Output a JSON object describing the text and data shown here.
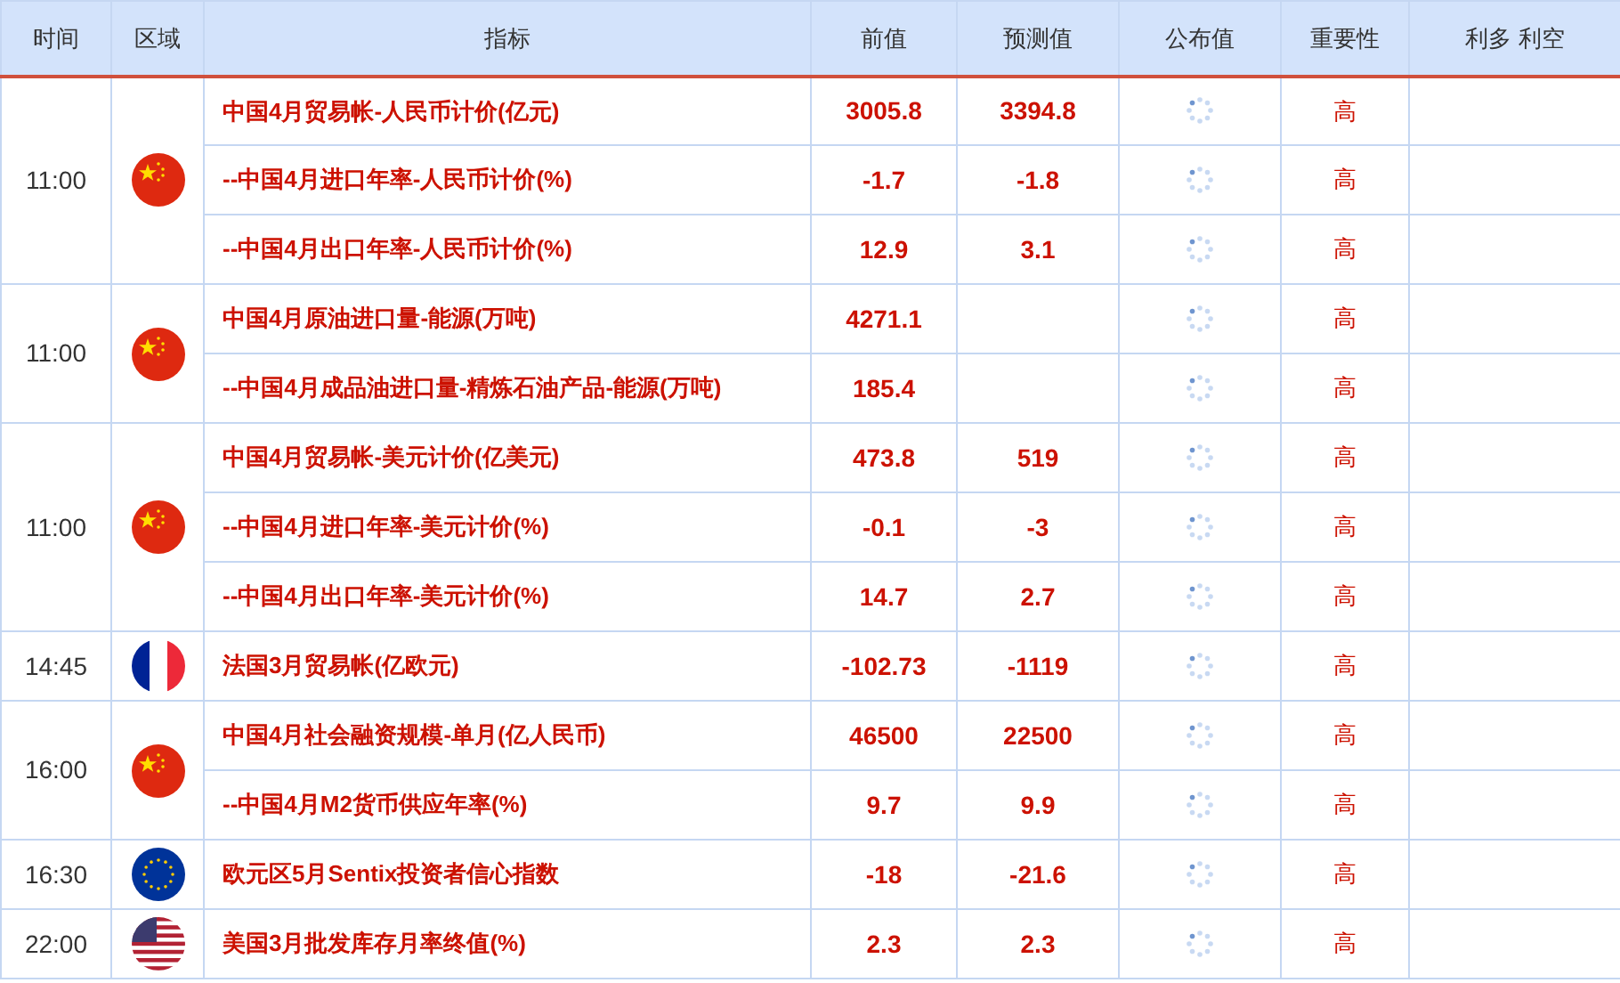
{
  "columns": [
    "时间",
    "区域",
    "指标",
    "前值",
    "预测值",
    "公布值",
    "重要性",
    "利多 利空"
  ],
  "groups": [
    {
      "time": "11:00",
      "kind": "cn",
      "rows": [
        {
          "indicator": "中国4月贸易帐-人民币计价(亿元)",
          "previous": "3005.8",
          "forecast": "3394.8",
          "importance": "高"
        },
        {
          "indicator": "--中国4月进口年率-人民币计价(%)",
          "previous": "-1.7",
          "forecast": "-1.8",
          "importance": "高"
        },
        {
          "indicator": "--中国4月出口年率-人民币计价(%)",
          "previous": "12.9",
          "forecast": "3.1",
          "importance": "高"
        }
      ]
    },
    {
      "time": "11:00",
      "kind": "cn",
      "rows": [
        {
          "indicator": "中国4月原油进口量-能源(万吨)",
          "previous": "4271.1",
          "importance": "高"
        },
        {
          "indicator": "--中国4月成品油进口量-精炼石油产品-能源(万吨)",
          "previous": "185.4",
          "importance": "高"
        }
      ]
    },
    {
      "time": "11:00",
      "kind": "cn",
      "rows": [
        {
          "indicator": "中国4月贸易帐-美元计价(亿美元)",
          "previous": "473.8",
          "forecast": "519",
          "importance": "高"
        },
        {
          "indicator": "--中国4月进口年率-美元计价(%)",
          "previous": "-0.1",
          "forecast": "-3",
          "importance": "高"
        },
        {
          "indicator": "--中国4月出口年率-美元计价(%)",
          "previous": "14.7",
          "forecast": "2.7",
          "importance": "高"
        }
      ]
    },
    {
      "time": "14:45",
      "kind": "fr",
      "rows": [
        {
          "indicator": "法国3月贸易帐(亿欧元)",
          "previous": "-102.73",
          "forecast": "-1119",
          "importance": "高"
        }
      ]
    },
    {
      "time": "16:00",
      "kind": "cn",
      "rows": [
        {
          "indicator": "中国4月社会融资规模-单月(亿人民币)",
          "previous": "46500",
          "forecast": "22500",
          "importance": "高"
        },
        {
          "indicator": "--中国4月M2货币供应年率(%)",
          "previous": "9.7",
          "forecast": "9.9",
          "importance": "高"
        }
      ]
    },
    {
      "time": "16:30",
      "kind": "eu",
      "rows": [
        {
          "indicator": "欧元区5月Sentix投资者信心指数",
          "previous": "-18",
          "forecast": "-21.6",
          "importance": "高"
        }
      ]
    },
    {
      "time": "22:00",
      "kind": "us",
      "rows": [
        {
          "indicator": "美国3月批发库存月率终值(%)",
          "previous": "2.3",
          "forecast": "2.3",
          "importance": "高"
        }
      ]
    }
  ]
}
